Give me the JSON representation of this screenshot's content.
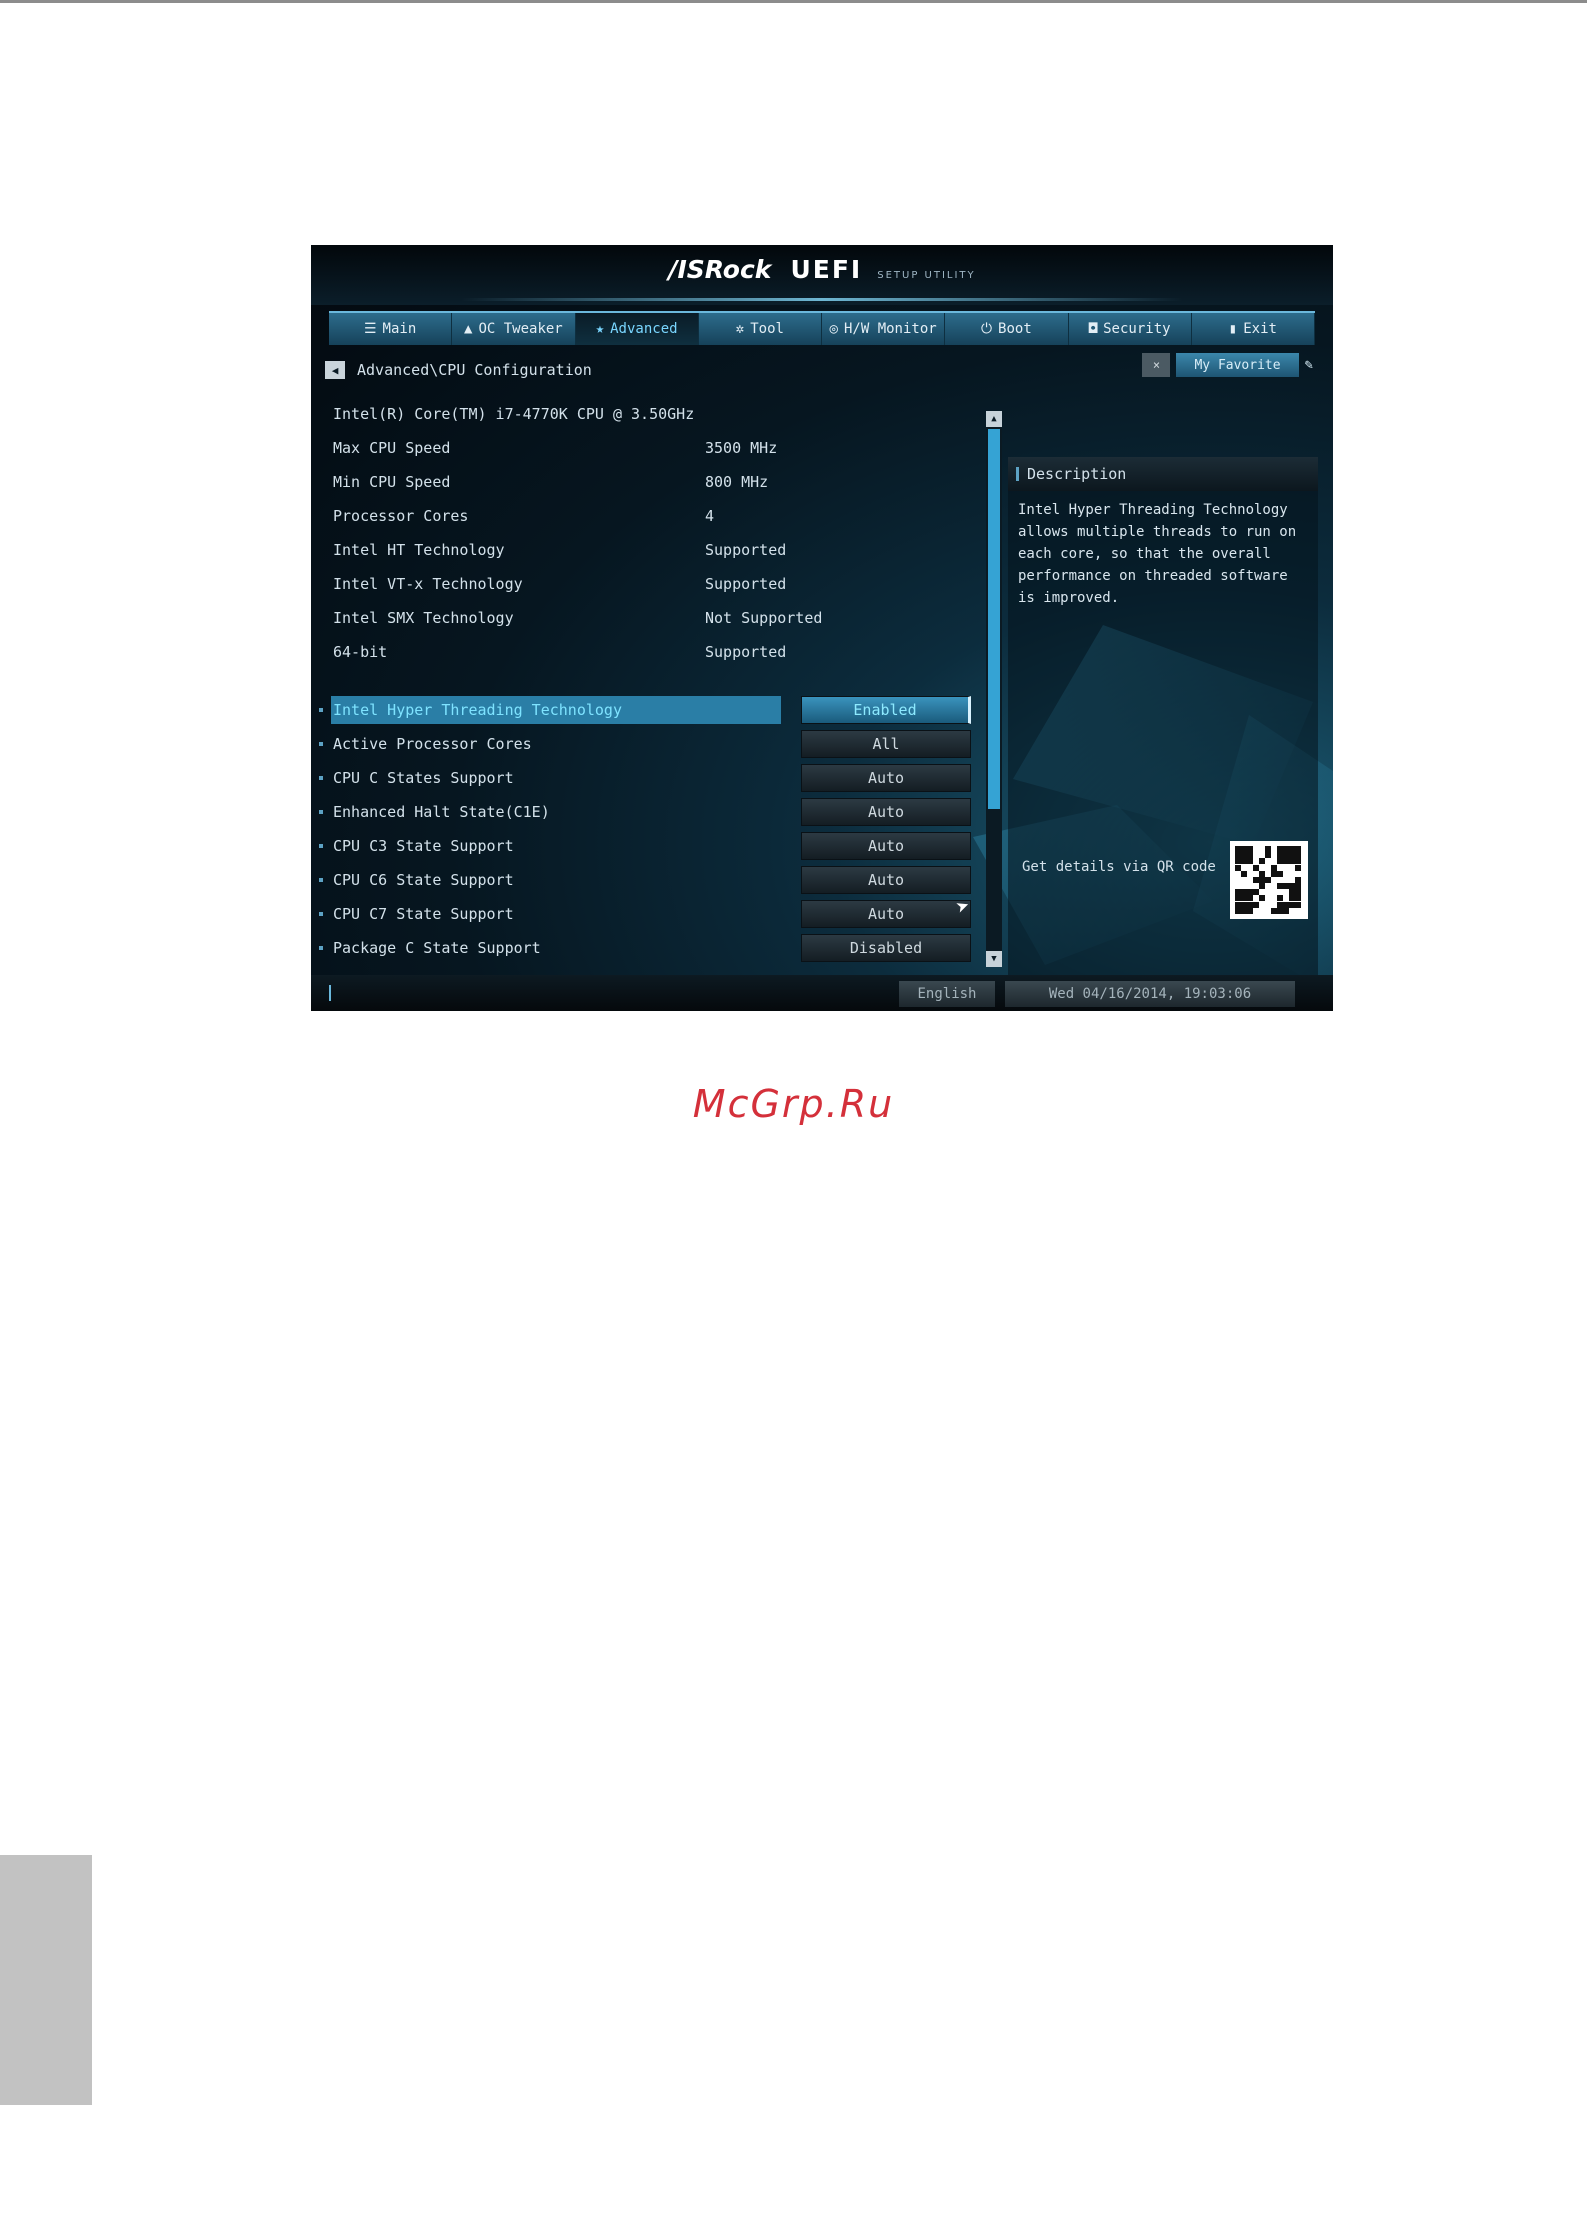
{
  "header": {
    "brand": "/ISRock",
    "product": "UEFI",
    "subtitle": "SETUP UTILITY"
  },
  "tabs": [
    {
      "label": "Main",
      "icon": "list-icon",
      "glyph": "☰",
      "active": false
    },
    {
      "label": "OC Tweaker",
      "icon": "flask-icon",
      "glyph": "▲",
      "active": false
    },
    {
      "label": "Advanced",
      "icon": "star-icon",
      "glyph": "★",
      "active": true
    },
    {
      "label": "Tool",
      "icon": "tool-icon",
      "glyph": "✲",
      "active": false
    },
    {
      "label": "H/W Monitor",
      "icon": "monitor-icon",
      "glyph": "◎",
      "active": false
    },
    {
      "label": "Boot",
      "icon": "power-icon",
      "glyph": "⏻",
      "active": false
    },
    {
      "label": "Security",
      "icon": "shield-icon",
      "glyph": "◘",
      "active": false
    },
    {
      "label": "Exit",
      "icon": "exit-icon",
      "glyph": "▮",
      "active": false
    }
  ],
  "breadcrumb": "Advanced\\CPU Configuration",
  "favorite": {
    "close": "×",
    "label": "My Favorite"
  },
  "cpu_info": {
    "title": "Intel(R) Core(TM) i7-4770K CPU @ 3.50GHz",
    "rows": [
      {
        "key": "Max CPU Speed",
        "value": "3500 MHz"
      },
      {
        "key": "Min CPU Speed",
        "value": "800 MHz"
      },
      {
        "key": "Processor Cores",
        "value": "4"
      },
      {
        "key": "Intel HT Technology",
        "value": "Supported"
      },
      {
        "key": "Intel VT-x Technology",
        "value": "Supported"
      },
      {
        "key": "Intel SMX Technology",
        "value": "Not Supported"
      },
      {
        "key": "64-bit",
        "value": "Supported"
      }
    ]
  },
  "options": [
    {
      "label": "Intel Hyper Threading Technology",
      "value": "Enabled",
      "selected": true
    },
    {
      "label": "Active Processor Cores",
      "value": "All",
      "selected": false
    },
    {
      "label": "CPU C States Support",
      "value": "Auto",
      "selected": false
    },
    {
      "label": "Enhanced Halt State(C1E)",
      "value": "Auto",
      "selected": false
    },
    {
      "label": "CPU C3 State Support",
      "value": "Auto",
      "selected": false
    },
    {
      "label": "CPU C6 State Support",
      "value": "Auto",
      "selected": false
    },
    {
      "label": "CPU C7 State Support",
      "value": "Auto",
      "selected": false
    },
    {
      "label": "Package C State Support",
      "value": "Disabled",
      "selected": false
    }
  ],
  "description": {
    "title": "Description",
    "text": "Intel Hyper Threading Technology allows multiple threads to run on each core, so that the overall performance on threaded software is improved.",
    "qr_label": "Get details via QR code"
  },
  "footer": {
    "language": "English",
    "datetime": "Wed 04/16/2014, 19:03:06"
  },
  "page": {
    "watermark": "McGrp.Ru"
  },
  "colors": {
    "accent": "#35a3d4",
    "selected_text": "#7ee3ff",
    "watermark": "#d4303a"
  }
}
